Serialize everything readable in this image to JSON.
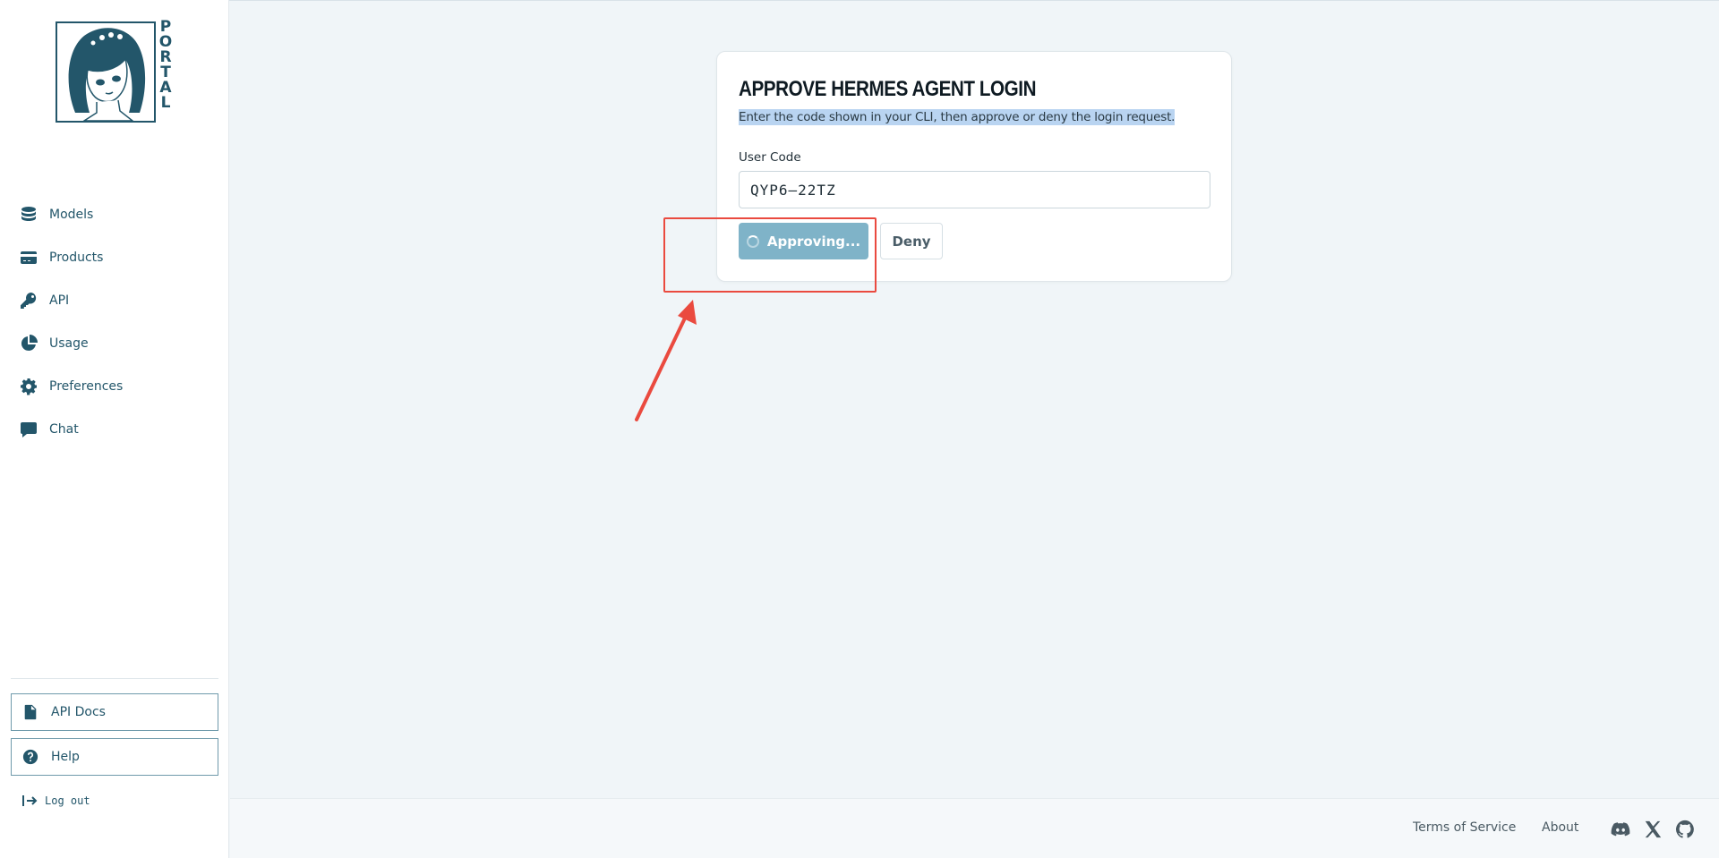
{
  "brand": {
    "name": "PORTAL",
    "logo_icon": "anime-girl-portrait-logo",
    "color": "#23566a"
  },
  "sidebar": {
    "nav": [
      {
        "label": "Models",
        "icon": "database-icon"
      },
      {
        "label": "Products",
        "icon": "credit-card-icon"
      },
      {
        "label": "API",
        "icon": "key-icon"
      },
      {
        "label": "Usage",
        "icon": "pie-chart-icon"
      },
      {
        "label": "Preferences",
        "icon": "gear-icon"
      },
      {
        "label": "Chat",
        "icon": "chat-bubble-icon"
      }
    ],
    "api_docs_label": "API Docs",
    "help_label": "Help",
    "logout_label": "Log out"
  },
  "card": {
    "title": "APPROVE HERMES AGENT LOGIN",
    "subtitle": "Enter the code shown in your CLI, then approve or deny the login request.",
    "user_code_label": "User Code",
    "user_code_value": "QYP6–22TZ",
    "approve_label": "Approving...",
    "deny_label": "Deny",
    "approve_color": "#7fb3c8"
  },
  "annotation": {
    "color": "#ea4a3f"
  },
  "footer": {
    "terms_label": "Terms of Service",
    "about_label": "About",
    "icons": [
      "discord-icon",
      "x-twitter-icon",
      "github-icon"
    ]
  }
}
